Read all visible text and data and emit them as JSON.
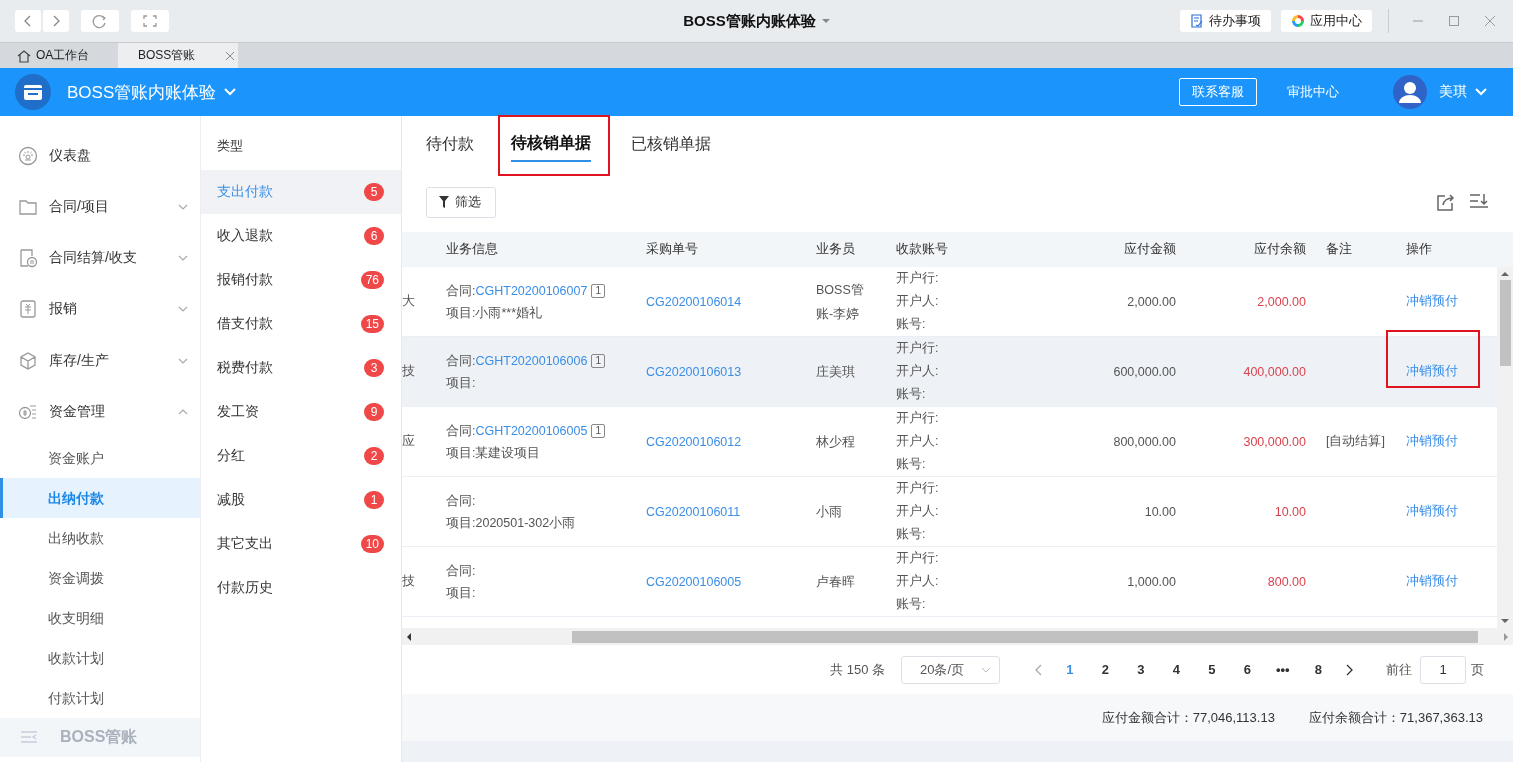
{
  "window": {
    "title": "BOSS管账内账体验",
    "toolbar": [
      {
        "label": "待办事项"
      },
      {
        "label": "应用中心"
      }
    ]
  },
  "browser_tabs": [
    {
      "label": "OA工作台",
      "selected": false,
      "closable": false
    },
    {
      "label": "BOSS管账",
      "selected": true,
      "closable": true
    }
  ],
  "app_header": {
    "company": "BOSS管账内账体验",
    "service_button": "联系客服",
    "approval_link": "审批中心",
    "user": "美琪"
  },
  "sidebar": {
    "items": [
      {
        "label": "仪表盘"
      },
      {
        "label": "合同/项目",
        "expanded": false
      },
      {
        "label": "合同结算/收支",
        "expanded": false
      },
      {
        "label": "报销",
        "expanded": false
      },
      {
        "label": "库存/生产",
        "expanded": false
      },
      {
        "label": "资金管理",
        "expanded": true,
        "children": [
          {
            "label": "资金账户",
            "selected": false
          },
          {
            "label": "出纳付款",
            "selected": true
          },
          {
            "label": "出纳收款",
            "selected": false
          },
          {
            "label": "资金调拨",
            "selected": false
          },
          {
            "label": "收支明细",
            "selected": false
          },
          {
            "label": "收款计划",
            "selected": false
          },
          {
            "label": "付款计划",
            "selected": false
          }
        ]
      }
    ],
    "footer": "BOSS管账"
  },
  "type_panel": {
    "title": "类型",
    "items": [
      {
        "label": "支出付款",
        "count": "5",
        "selected": true
      },
      {
        "label": "收入退款",
        "count": "6",
        "selected": false
      },
      {
        "label": "报销付款",
        "count": "76",
        "selected": false
      },
      {
        "label": "借支付款",
        "count": "15",
        "selected": false
      },
      {
        "label": "税费付款",
        "count": "3",
        "selected": false
      },
      {
        "label": "发工资",
        "count": "9",
        "selected": false
      },
      {
        "label": "分红",
        "count": "2",
        "selected": false
      },
      {
        "label": "减股",
        "count": "1",
        "selected": false
      },
      {
        "label": "其它支出",
        "count": "10",
        "selected": false
      },
      {
        "label": "付款历史",
        "selected": false
      }
    ]
  },
  "tabs": [
    {
      "label": "待付款",
      "selected": false,
      "highlighted": false
    },
    {
      "label": "待核销单据",
      "selected": true,
      "highlighted": true
    },
    {
      "label": "已核销单据",
      "selected": false,
      "highlighted": false
    }
  ],
  "filter_button": "筛选",
  "table": {
    "columns": [
      "",
      "业务信息",
      "采购单号",
      "业务员",
      "收款账号",
      "应付金额",
      "应付余额",
      "备注",
      "操作"
    ],
    "rows": [
      {
        "column_1": "大",
        "contract_label": "合同:",
        "contract_no": "CGHT20200106007",
        "contract_count": "1",
        "project": "项目:小雨***婚礼",
        "order_no": "CG20200106014",
        "salesperson": "BOSS管账-李婷",
        "account": [
          "开户行:",
          "开户人:",
          "账号:"
        ],
        "amount": "2,000.00",
        "remaining": "2,000.00",
        "action": "冲销预付",
        "hovered": false,
        "highlighted": false
      },
      {
        "column_1": "技",
        "contract_label": "合同:",
        "contract_no": "CGHT20200106006",
        "contract_count": "1",
        "project": "项目:",
        "order_no": "CG20200106013",
        "salesperson": "庄美琪",
        "account": [
          "开户行:",
          "开户人:",
          "账号:"
        ],
        "amount": "600,000.00",
        "remaining": "400,000.00",
        "action": "冲销预付",
        "hovered": true,
        "highlighted": true
      },
      {
        "column_1": "应",
        "contract_label": "合同:",
        "contract_no": "CGHT20200106005",
        "contract_count": "1",
        "project": "项目:某建设项目",
        "order_no": "CG20200106012",
        "salesperson": "林少程",
        "account": [
          "开户行:",
          "开户人:",
          "账号:"
        ],
        "amount": "800,000.00",
        "remaining": "300,000.00",
        "note": "[自动结算]",
        "action": "冲销预付",
        "hovered": false,
        "highlighted": false
      },
      {
        "contract_label": "合同:",
        "project": "项目:2020501-302小雨",
        "order_no": "CG20200106011",
        "salesperson": "小雨",
        "account": [
          "开户行:",
          "开户人:",
          "账号:"
        ],
        "amount": "10.00",
        "remaining": "10.00",
        "action": "冲销预付",
        "hovered": false,
        "highlighted": false
      },
      {
        "column_1": "技",
        "contract_label": "合同:",
        "project": "项目:",
        "order_no": "CG20200106005",
        "salesperson": "卢春晖",
        "account": [
          "开户行:",
          "开户人:",
          "账号:"
        ],
        "amount": "1,000.00",
        "remaining": "800.00",
        "action": "冲销预付",
        "hovered": false,
        "highlighted": false
      }
    ]
  },
  "pagination": {
    "total": "共 150 条",
    "page_size": "20条/页",
    "pages": [
      {
        "label": "1",
        "selected": true
      },
      {
        "label": "2",
        "selected": false
      },
      {
        "label": "3",
        "selected": false
      },
      {
        "label": "4",
        "selected": false
      },
      {
        "label": "5",
        "selected": false
      },
      {
        "label": "6",
        "selected": false
      },
      {
        "label": "•••",
        "selected": false
      },
      {
        "label": "8",
        "selected": false
      }
    ],
    "goto_label": "前往",
    "goto_value": "1",
    "goto_suffix": "页"
  },
  "totals": [
    "应付金额合计：77,046,113.13",
    "应付余额合计：71,367,363.13"
  ]
}
